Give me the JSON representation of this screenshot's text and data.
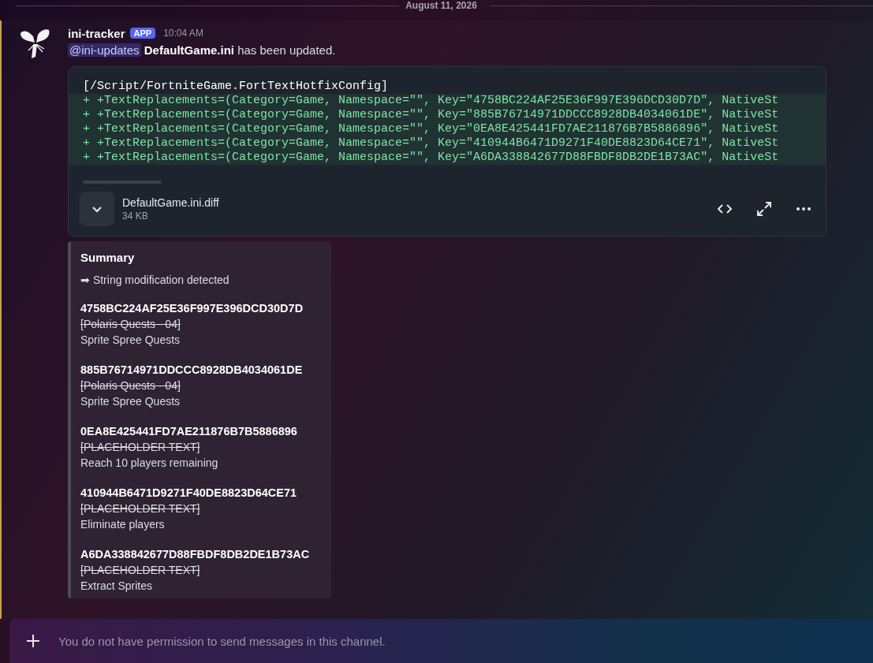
{
  "divider": {
    "date": "August 11, 2026"
  },
  "message": {
    "author": "ini-tracker",
    "badge": "APP",
    "time": "10:04 AM",
    "mentioned": true,
    "mention": "@ini-updates",
    "file_name": "DefaultGame.ini",
    "text": "has been updated.",
    "code_lines": [
      {
        "kind": "header",
        "text": "[/Script/FortniteGame.FortTextHotfixConfig]"
      },
      {
        "kind": "added",
        "text": "+ +TextReplacements=(Category=Game, Namespace=\"\", Key=\"4758BC224AF25E36F997E396DCD30D7D\", NativeSt"
      },
      {
        "kind": "added",
        "text": "+ +TextReplacements=(Category=Game, Namespace=\"\", Key=\"885B76714971DDCCC8928DB4034061DE\", NativeSt"
      },
      {
        "kind": "added",
        "text": "+ +TextReplacements=(Category=Game, Namespace=\"\", Key=\"0EA8E425441FD7AE211876B7B5886896\", NativeSt"
      },
      {
        "kind": "added",
        "text": "+ +TextReplacements=(Category=Game, Namespace=\"\", Key=\"410944B6471D9271F40DE8823D64CE71\", NativeSt"
      },
      {
        "kind": "added",
        "text": "+ +TextReplacements=(Category=Game, Namespace=\"\", Key=\"A6DA338842677D88FBDF8DB2DE1B73AC\", NativeSt"
      }
    ],
    "attachment": {
      "name": "DefaultGame.ini.diff",
      "size": "34 KB"
    },
    "embed": {
      "title": "Summary",
      "subtitle": "➡ String modification detected",
      "entries": [
        {
          "key": "4758BC224AF25E36F997E396DCD30D7D",
          "old": "[Polaris Quests - 04]",
          "new": "Sprite Spree Quests"
        },
        {
          "key": "885B76714971DDCCC8928DB4034061DE",
          "old": "[Polaris Quests - 04]",
          "new": "Sprite Spree Quests"
        },
        {
          "key": "0EA8E425441FD7AE211876B7B5886896",
          "old": "[PLACEHOLDER TEXT]",
          "new": "Reach 10 players remaining"
        },
        {
          "key": "410944B6471D9271F40DE8823D64CE71",
          "old": "[PLACEHOLDER TEXT]",
          "new": "Eliminate players"
        },
        {
          "key": "A6DA338842677D88FBDF8DB2DE1B73AC",
          "old": "[PLACEHOLDER TEXT]",
          "new": "Extract Sprites"
        }
      ]
    }
  },
  "composer": {
    "placeholder": "You do not have permission to send messages in this channel."
  }
}
